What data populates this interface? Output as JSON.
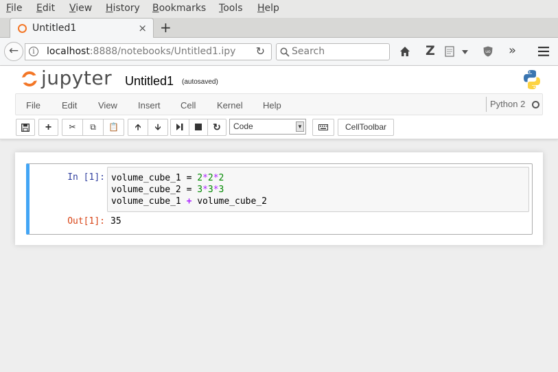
{
  "browser": {
    "menu": [
      {
        "mnemonic": "F",
        "rest": "ile"
      },
      {
        "mnemonic": "E",
        "rest": "dit"
      },
      {
        "mnemonic": "V",
        "rest": "iew"
      },
      {
        "mnemonic": "H",
        "rest": "istory"
      },
      {
        "mnemonic": "B",
        "rest": "ookmarks"
      },
      {
        "mnemonic": "T",
        "rest": "ools"
      },
      {
        "mnemonic": "H",
        "rest": "elp"
      }
    ],
    "tab_title": "Untitled1",
    "tab_close": "×",
    "new_tab": "+",
    "url_host": "localhost",
    "url_rest": ":8888/notebooks/Untitled1.ipy",
    "search_placeholder": "Search",
    "icons": [
      "back-arrow-icon",
      "info-icon",
      "reload-icon",
      "search-icon",
      "home-icon",
      "zotero-icon",
      "reader-icon",
      "chevron-down-icon",
      "ublock-icon",
      "overflow-icon",
      "hamburger-menu-icon"
    ]
  },
  "jupyter": {
    "logo_text": "jupyter",
    "notebook_name": "Untitled1",
    "autosave": "(autosaved)",
    "menu": [
      "File",
      "Edit",
      "View",
      "Insert",
      "Cell",
      "Kernel",
      "Help"
    ],
    "kernel_name": "Python 2",
    "toolbar": {
      "celltype": "Code",
      "celltoolbar": "CellToolbar",
      "icons": [
        "save-icon",
        "add-icon",
        "cut-icon",
        "copy-icon",
        "paste-icon",
        "move-up-icon",
        "move-down-icon",
        "run-icon",
        "stop-icon",
        "restart-icon",
        "keyboard-icon"
      ]
    },
    "accent": "#42a5f5",
    "brand": "#f37626"
  },
  "cell": {
    "in_prompt": "In [1]:",
    "out_prompt": "Out[1]:",
    "code_lines": [
      [
        "volume_cube_1 = ",
        "2",
        "*",
        "2",
        "*",
        "2"
      ],
      [
        "volume_cube_2 = ",
        "3",
        "*",
        "3",
        "*",
        "3"
      ],
      [
        "volume_cube_1 ",
        "+",
        " volume_cube_2"
      ]
    ],
    "output": "35"
  }
}
